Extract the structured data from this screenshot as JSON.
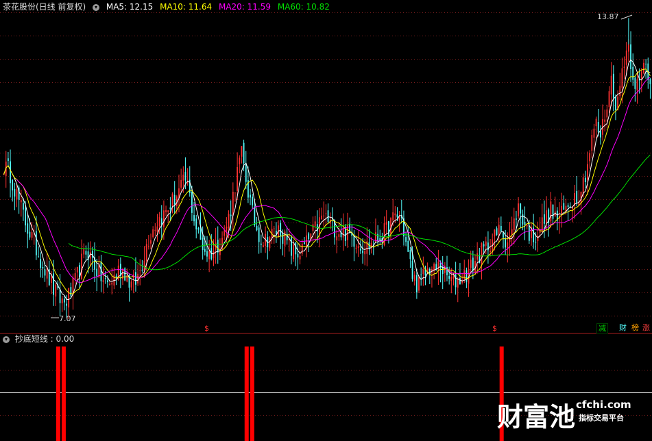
{
  "header": {
    "title": "茶花股份(日线 前复权)",
    "ma5": "MA5: 12.15",
    "ma10": "MA10: 11.64",
    "ma20": "MA20: 11.59",
    "ma60": "MA60: 10.82"
  },
  "colors": {
    "up": "#ff3232",
    "down": "#54fcfc",
    "ma5": "#ffffff",
    "ma10": "#ffff00",
    "ma20": "#ff00ff",
    "ma60": "#00e000",
    "grid": "#7a1e1e",
    "signal_bar": "#ff0000"
  },
  "annotations": {
    "high_label": "13.87",
    "low_label": "7.07",
    "marker_glyph": "$"
  },
  "badges": [
    {
      "text": "减",
      "color": "#00d000"
    },
    {
      "text": "财",
      "color": "#54fcfc"
    },
    {
      "text": "榜",
      "color": "#ffa000"
    },
    {
      "text": "涨",
      "color": "#ff4040"
    }
  ],
  "indicator": {
    "name": "抄底短线",
    "value": ": 0.00"
  },
  "watermark": {
    "brand": "财富池",
    "url": "cfchi.com",
    "slogan": "指标交易平台"
  },
  "chart_data": {
    "type": "candlestick",
    "price_range": [
      7.0,
      14.0
    ],
    "high": 13.87,
    "low": 7.07,
    "grid": true,
    "close_path": [
      10.5,
      10.4,
      10.0,
      9.6,
      9.2,
      8.9,
      8.6,
      8.3,
      8.0,
      7.7,
      7.5,
      7.4,
      7.6,
      7.9,
      8.3,
      8.6,
      8.4,
      8.1,
      7.9,
      7.8,
      8.0,
      8.2,
      8.1,
      7.8,
      7.9,
      8.3,
      8.8,
      9.1,
      9.3,
      9.4,
      9.6,
      9.8,
      10.0,
      10.2,
      9.6,
      9.0,
      8.7,
      8.5,
      8.6,
      8.8,
      9.0,
      9.5,
      10.2,
      10.8,
      10.1,
      9.4,
      9.0,
      8.8,
      8.9,
      9.0,
      9.1,
      8.8,
      8.6,
      8.5,
      8.6,
      8.8,
      9.0,
      9.2,
      9.4,
      9.2,
      9.1,
      9.0,
      9.0,
      8.9,
      8.8,
      8.7,
      8.7,
      8.8,
      8.9,
      9.0,
      9.2,
      9.4,
      9.3,
      8.6,
      8.0,
      7.8,
      8.0,
      8.2,
      8.1,
      8.3,
      8.0,
      7.9,
      7.9,
      8.0,
      8.1,
      8.3,
      8.5,
      8.6,
      8.8,
      8.9,
      9.1,
      8.8,
      9.0,
      9.6,
      9.3,
      9.0,
      8.9,
      9.1,
      9.3,
      9.5,
      9.3,
      9.4,
      9.6,
      9.8,
      9.9,
      10.2,
      10.8,
      11.5,
      11.2,
      11.8,
      12.5,
      11.8,
      12.8,
      13.3,
      12.5,
      12.3,
      12.9,
      12.4
    ],
    "signal_positions": [
      {
        "index": 10,
        "height": 1.0
      },
      {
        "index": 11,
        "height": 1.0
      },
      {
        "index": 44,
        "height": 1.0
      },
      {
        "index": 45,
        "height": 1.0
      },
      {
        "index": 90,
        "height": 1.0
      }
    ],
    "indicator_value": 0.0
  }
}
